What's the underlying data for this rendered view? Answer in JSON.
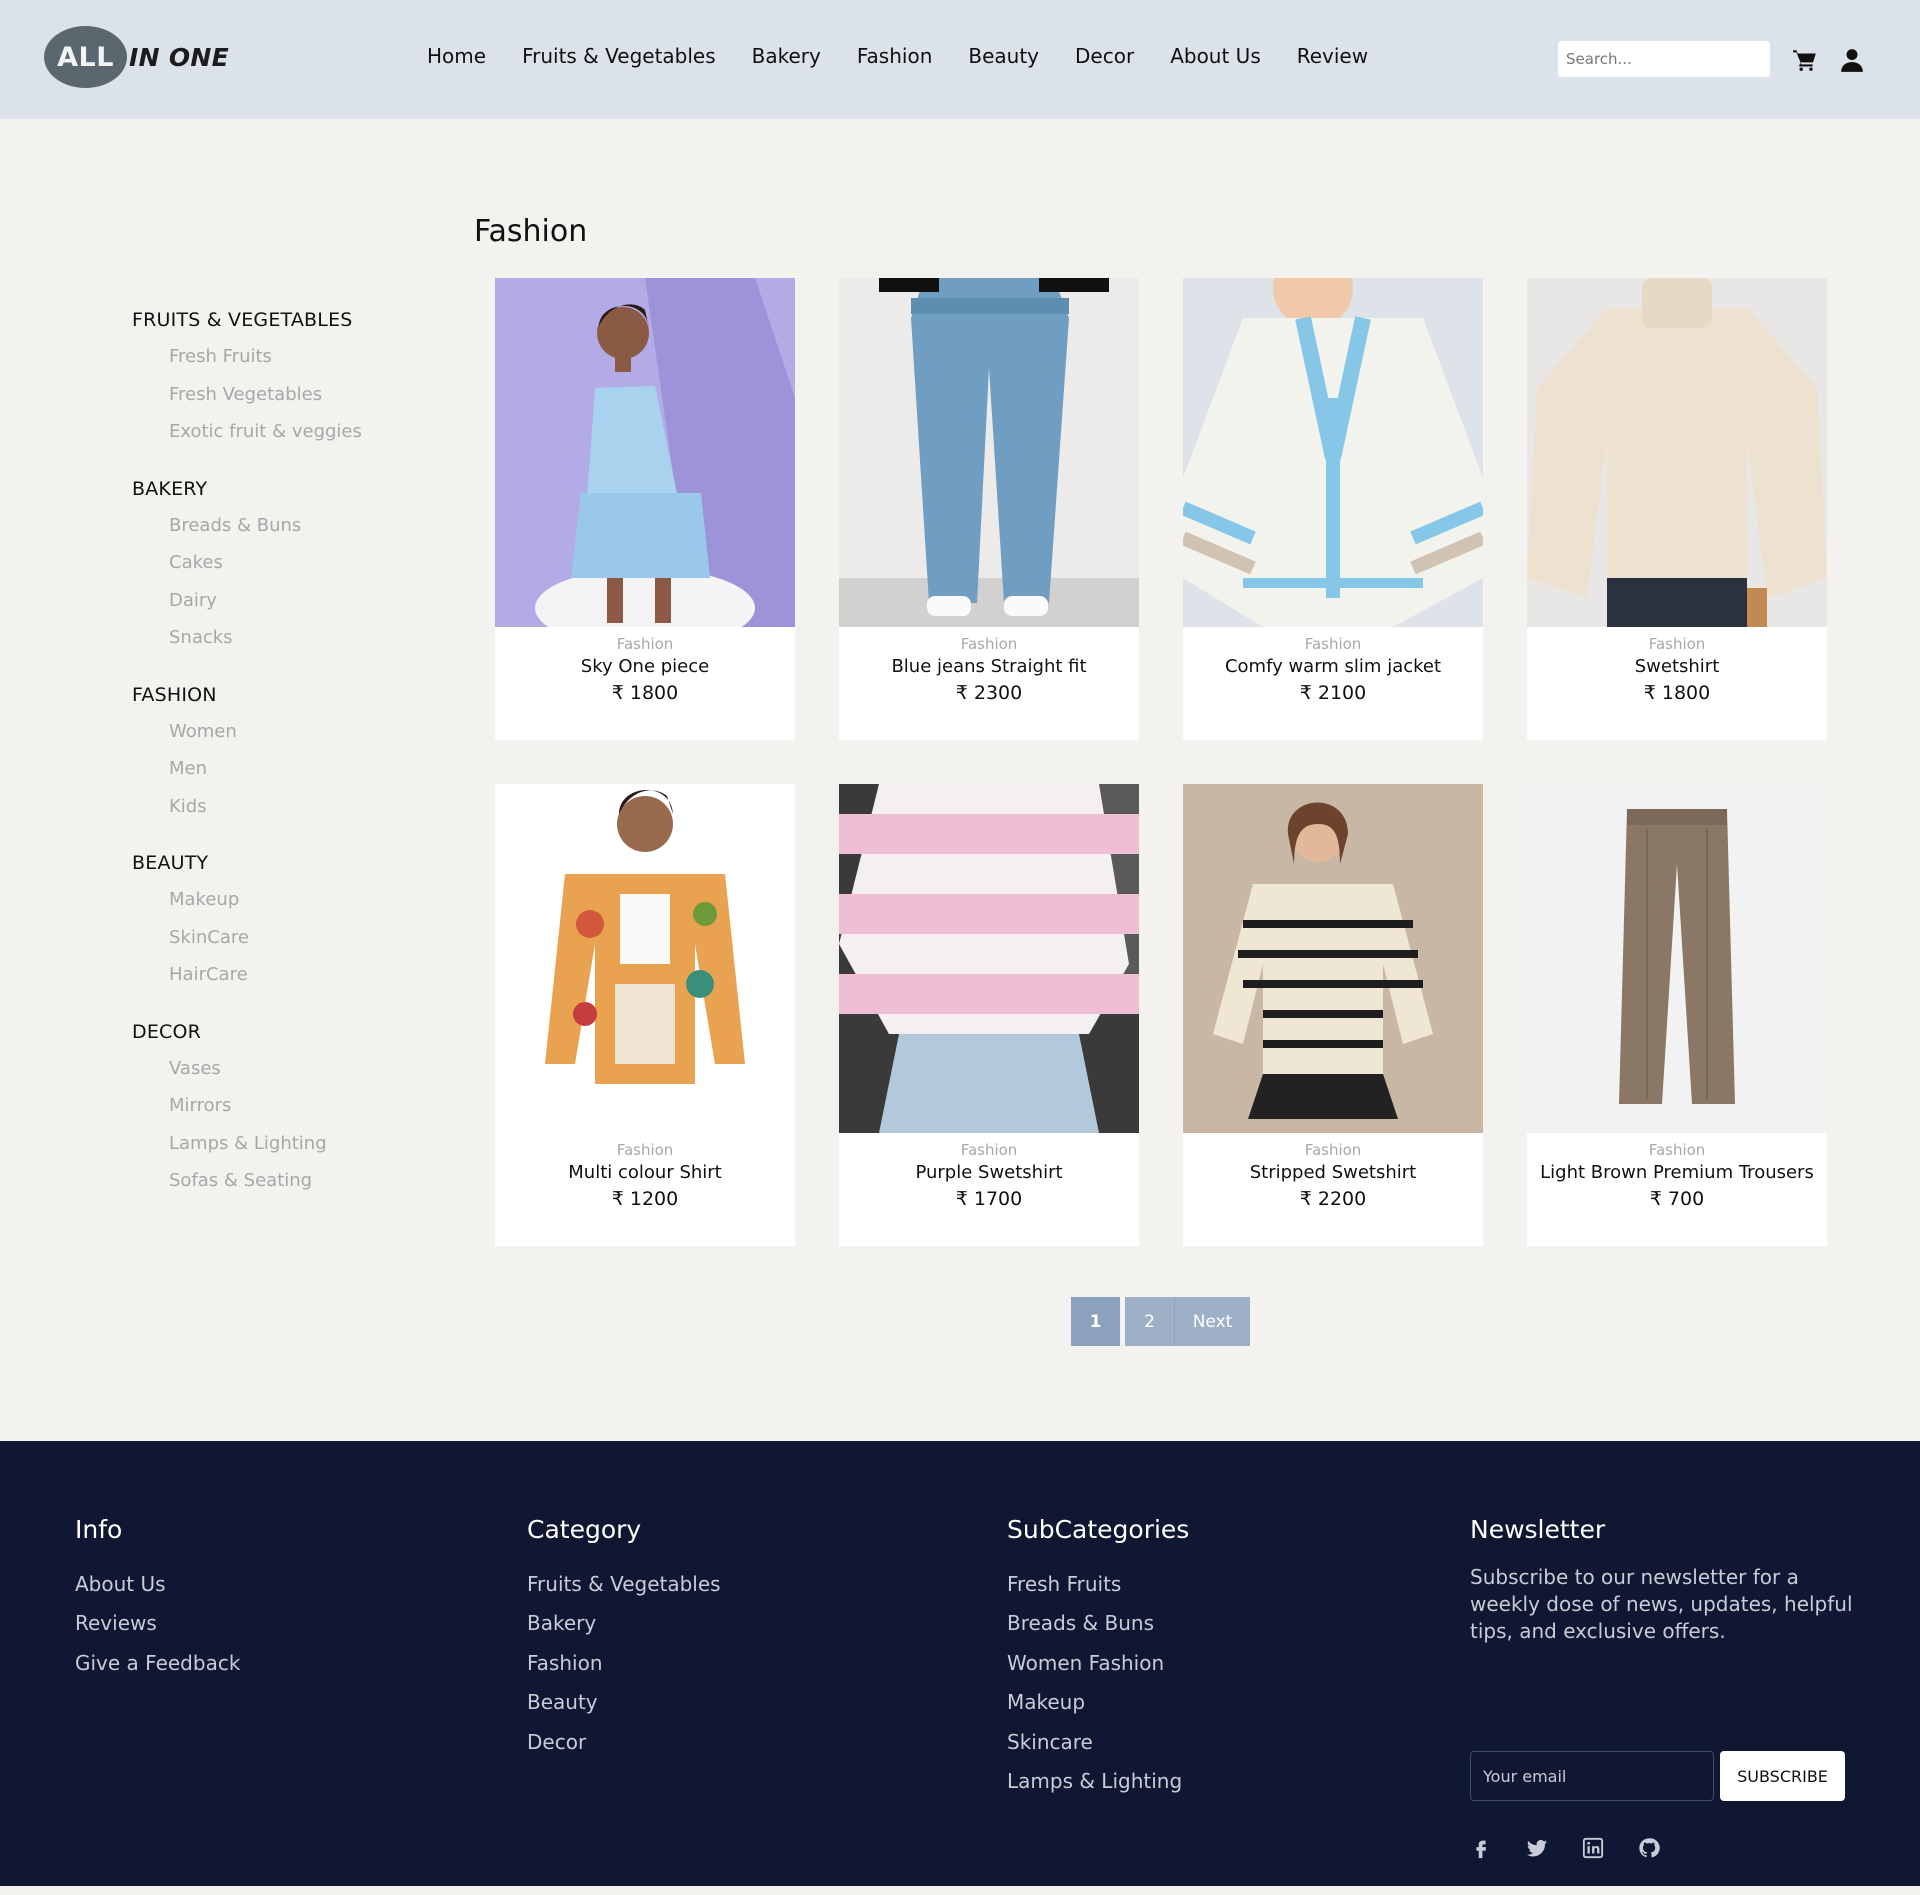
{
  "brand": {
    "badge": "ALL",
    "text": "IN ONE"
  },
  "nav": [
    "Home",
    "Fruits & Vegetables",
    "Bakery",
    "Fashion",
    "Beauty",
    "Decor",
    "About Us",
    "Review"
  ],
  "search": {
    "placeholder": "Search..."
  },
  "header_icons": [
    "cart-icon",
    "user-icon"
  ],
  "sidebar": [
    {
      "title": "FRUITS & VEGETABLES",
      "items": [
        "Fresh Fruits",
        "Fresh Vegetables",
        "Exotic fruit & veggies"
      ]
    },
    {
      "title": "BAKERY",
      "items": [
        "Breads & Buns",
        "Cakes",
        "Dairy",
        "Snacks"
      ]
    },
    {
      "title": "FASHION",
      "items": [
        "Women",
        "Men",
        "Kids"
      ]
    },
    {
      "title": "BEAUTY",
      "items": [
        "Makeup",
        "SkinCare",
        "HairCare"
      ]
    },
    {
      "title": "DECOR",
      "items": [
        "Vases",
        "Mirrors",
        "Lamps & Lighting",
        "Sofas & Seating"
      ]
    }
  ],
  "page_title": "Fashion",
  "products": [
    {
      "category": "Fashion",
      "name": "Sky One piece",
      "price": "₹ 1800",
      "image": "dress"
    },
    {
      "category": "Fashion",
      "name": "Blue jeans Straight fit",
      "price": "₹ 2300",
      "image": "jeans"
    },
    {
      "category": "Fashion",
      "name": "Comfy warm slim jacket",
      "price": "₹ 2100",
      "image": "cardigan"
    },
    {
      "category": "Fashion",
      "name": "Swetshirt",
      "price": "₹ 1800",
      "image": "sweater"
    },
    {
      "category": "Fashion",
      "name": "Multi colour Shirt",
      "price": "₹ 1200",
      "image": "shirt"
    },
    {
      "category": "Fashion",
      "name": "Purple Swetshirt",
      "price": "₹ 1700",
      "image": "pink-sweater"
    },
    {
      "category": "Fashion",
      "name": "Stripped Swetshirt",
      "price": "₹ 2200",
      "image": "striped"
    },
    {
      "category": "Fashion",
      "name": "Light Brown Premium Trousers",
      "price": "₹ 700",
      "image": "trousers"
    }
  ],
  "pagination": {
    "pages": [
      "1",
      "2"
    ],
    "active": "1",
    "next": "Next"
  },
  "footer": {
    "info": {
      "title": "Info",
      "links": [
        "About Us",
        "Reviews",
        "Give a Feedback"
      ]
    },
    "category": {
      "title": "Category",
      "links": [
        "Fruits & Vegetables",
        "Bakery",
        "Fashion",
        "Beauty",
        "Decor"
      ]
    },
    "subcategories": {
      "title": "SubCategories",
      "links": [
        "Fresh Fruits",
        "Breads & Buns",
        "Women Fashion",
        "Makeup",
        "Skincare",
        "Lamps & Lighting"
      ]
    },
    "newsletter": {
      "title": "Newsletter",
      "text": "Subscribe to our newsletter for a weekly dose of news, updates, helpful tips, and exclusive offers.",
      "email_placeholder": "Your email",
      "button": "SUBSCRIBE"
    },
    "social": [
      "facebook-icon",
      "twitter-icon",
      "linkedin-icon",
      "github-icon"
    ]
  },
  "colors": {
    "header_bg": "#dce2e9",
    "page_bg": "#f3f2ef",
    "footer_bg": "#101732",
    "pager": "#9db0c6"
  }
}
